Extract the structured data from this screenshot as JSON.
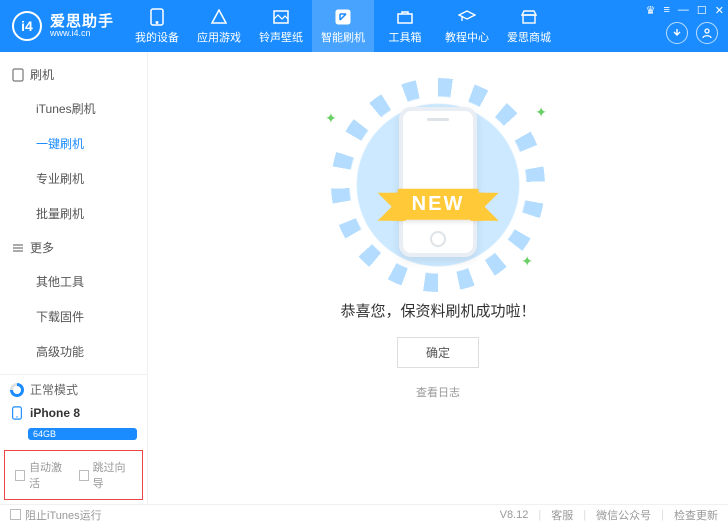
{
  "brand": {
    "name": "爱思助手",
    "url": "www.i4.cn",
    "logo_text": "i4"
  },
  "topnav": [
    {
      "label": "我的设备"
    },
    {
      "label": "应用游戏"
    },
    {
      "label": "铃声壁纸"
    },
    {
      "label": "智能刷机"
    },
    {
      "label": "工具箱"
    },
    {
      "label": "教程中心"
    },
    {
      "label": "爱思商城"
    }
  ],
  "sidebar": {
    "group1": "刷机",
    "items1": [
      "iTunes刷机",
      "一键刷机",
      "专业刷机",
      "批量刷机"
    ],
    "group2": "更多",
    "items2": [
      "其他工具",
      "下载固件",
      "高级功能"
    ],
    "mode": "正常模式",
    "device": "iPhone 8",
    "storage": "64GB",
    "check_auto": "自动激活",
    "check_skip": "跳过向导"
  },
  "main": {
    "ribbon": "NEW",
    "message": "恭喜您，保资料刷机成功啦！",
    "ok": "确定",
    "log": "查看日志"
  },
  "statusbar": {
    "block_itunes": "阻止iTunes运行",
    "version": "V8.12",
    "support": "客服",
    "wechat": "微信公众号",
    "update": "检查更新"
  }
}
